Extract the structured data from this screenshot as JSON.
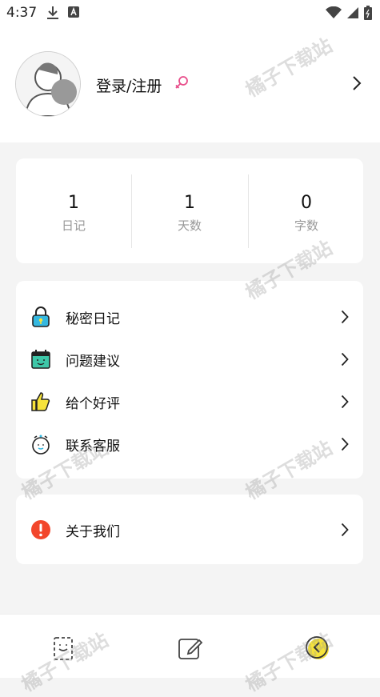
{
  "status_bar": {
    "time": "4:37"
  },
  "profile": {
    "login_label": "登录/注册"
  },
  "stats": [
    {
      "value": "1",
      "label": "日记"
    },
    {
      "value": "1",
      "label": "天数"
    },
    {
      "value": "0",
      "label": "字数"
    }
  ],
  "menu": [
    {
      "label": "秘密日记",
      "icon": "lock-icon"
    },
    {
      "label": "问题建议",
      "icon": "calendar-face-icon"
    },
    {
      "label": "给个好评",
      "icon": "thumbs-up-icon"
    },
    {
      "label": "联系客服",
      "icon": "alarm-clock-icon"
    }
  ],
  "about": {
    "label": "关于我们",
    "icon": "exclamation-icon"
  },
  "watermark_text": "橘子下载站",
  "colors": {
    "accent_yellow": "#f6e33a",
    "alert_red": "#f2462b",
    "teal": "#35c2b4"
  }
}
